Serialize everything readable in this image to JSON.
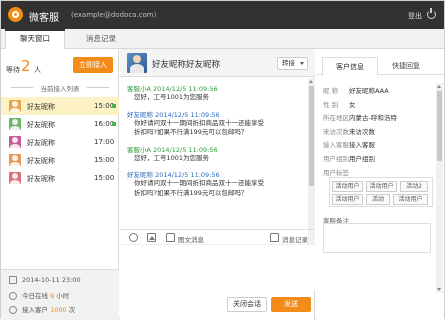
{
  "header": {
    "title": "微客服",
    "email": "(example@dodoca.com)",
    "logout": "登出"
  },
  "tabs": [
    {
      "label": "聊天窗口"
    },
    {
      "label": "消息记录"
    }
  ],
  "queue": {
    "prefix": "等待",
    "count": "2",
    "unit": "人",
    "button": "立即接入",
    "list_title": "当前接入列表"
  },
  "visitors": [
    {
      "name": "好友昵称",
      "time": "15:00",
      "color": "#e8a64a",
      "online": true
    },
    {
      "name": "好友昵称",
      "time": "16:00",
      "color": "#6db36a",
      "online": true
    },
    {
      "name": "好友昵称",
      "time": "17:00",
      "color": "#c25c9a",
      "online": false
    },
    {
      "name": "好友昵称",
      "time": "15:00",
      "color": "#e89a5c",
      "online": false
    },
    {
      "name": "好友昵称",
      "time": "15:00",
      "color": "#d8707c",
      "online": false
    }
  ],
  "stats": {
    "datetime": "2014-10-11  23:00",
    "today_prefix": "今日在线",
    "today_value": "9",
    "today_suffix": "小时",
    "access_prefix": "接入客户",
    "access_value": "1000",
    "access_suffix": "次"
  },
  "chat": {
    "contact_name": "好友昵称好友昵称",
    "transfer": "转接",
    "messages": [
      {
        "meta": "客服小A 2014/12/5 11:09:56",
        "kind": "agent",
        "lines": [
          "您好，工号1001为您服务"
        ]
      },
      {
        "meta": "好友昵称 2014/12/5 11:09:56",
        "kind": "user",
        "lines": [
          "你好请问双十一期间折扣商品双十一还能享受",
          "折扣吗?如果不行满199元可以包邮吗？"
        ]
      },
      {
        "meta": "客服小A 2014/12/5 11:09:56",
        "kind": "agent",
        "lines": [
          "您好，工号1001为您服务"
        ]
      },
      {
        "meta": "好友昵称 2014/12/5 11:09:56",
        "kind": "user",
        "lines": [
          "你好请问双十一期间折扣商品双十一还能享受",
          "折扣吗?如果不行满199元可以包邮吗？"
        ]
      }
    ],
    "toolbar_pic": "图文消息",
    "toolbar_history": "消息记录",
    "close_button": "关闭会话",
    "send_button": "发送"
  },
  "customer": {
    "tabs": [
      "客户信息",
      "快捷回复"
    ],
    "fields": [
      {
        "label": "昵    称",
        "value": "好友昵称AAA"
      },
      {
        "label": "性    别",
        "value": "女"
      },
      {
        "label": "所在地区",
        "value": "内蒙古-呼和浩特"
      },
      {
        "label": "来访次数",
        "value": "来访次数"
      },
      {
        "label": "接入客服",
        "value": "接入客服"
      },
      {
        "label": "用户组别",
        "value": "用户组别"
      }
    ],
    "tag_label": "用户标签",
    "tags": [
      "活动用户",
      "活动用户",
      "活动2",
      "活动用户",
      "活动",
      "活动用户"
    ],
    "note_label": "客服备注"
  }
}
